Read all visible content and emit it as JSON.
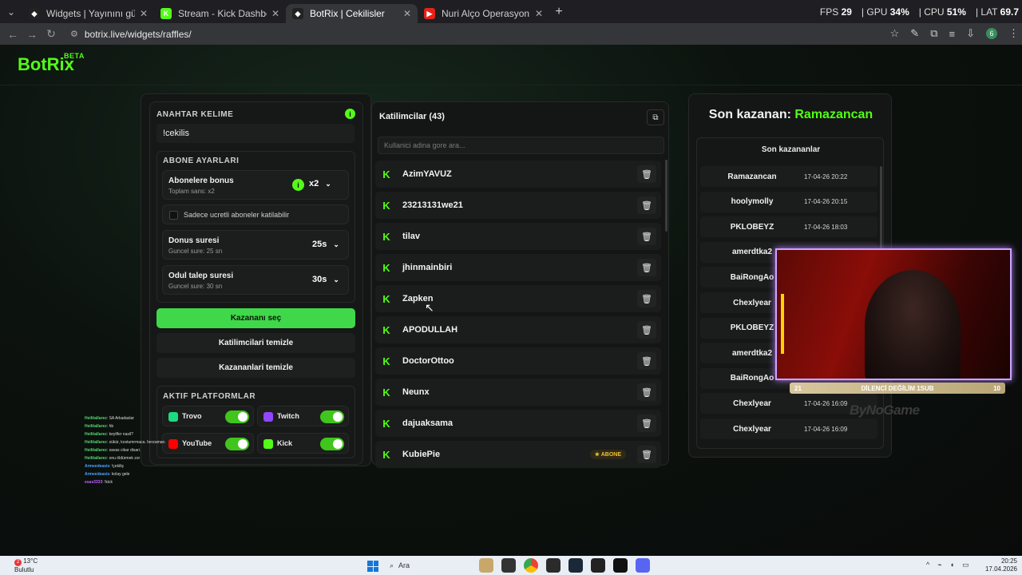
{
  "browser": {
    "tabs": [
      {
        "title": "Widgets | Yayınını güçlendirme…",
        "fav_color": "#222",
        "fav_glyph": "◆"
      },
      {
        "title": "Stream - Kick Dashboard",
        "fav_color": "#53fc18",
        "fav_glyph": "K"
      },
      {
        "title": "BotRix | Cekilisler",
        "fav_color": "#222",
        "fav_glyph": "◆"
      },
      {
        "title": "Nuri Alço Operasyon Müziği…",
        "fav_color": "#e62117",
        "fav_glyph": "▶"
      }
    ],
    "new_tab": "+",
    "url": "botrix.live/widgets/raffles/",
    "stats": {
      "fps_label": "FPS",
      "fps": "29",
      "gpu_label": "GPU",
      "gpu": "34",
      "cpu_label": "CPU",
      "cpu": "51",
      "lat_label": "LAT",
      "lat": "69.7"
    },
    "profile_initial": "6"
  },
  "brand": {
    "name": "BotRix",
    "beta": "BETA"
  },
  "settings": {
    "keyword_label": "ANAHTAR KELIME",
    "keyword_value": "!cekilis",
    "sub_settings_label": "ABONE AYARLARI",
    "sub_bonus_title": "Abonelere bonus",
    "sub_bonus_sub": "Toplam sans: x2",
    "sub_bonus_value": "x2",
    "paid_only_label": "Sadece ucretli aboneler katilabilir",
    "duration_title": "Donus suresi",
    "duration_sub": "Guncel sure: 25 sn",
    "duration_value": "25s",
    "claim_title": "Odul talep suresi",
    "claim_sub": "Guncel sure: 30 sn",
    "claim_value": "30s",
    "pick_winner": "Kazananı seç",
    "clear_participants": "Katilimcilari temizle",
    "clear_winners": "Kazananlari temizle",
    "platforms_label": "AKTIF PLATFORMLAR",
    "platforms": [
      {
        "name": "Trovo",
        "color": "#1cdb7f",
        "on": true
      },
      {
        "name": "Twitch",
        "color": "#9146ff",
        "on": true
      },
      {
        "name": "YouTube",
        "color": "#ff0000",
        "on": true
      },
      {
        "name": "Kick",
        "color": "#53fc18",
        "on": true
      }
    ]
  },
  "participants": {
    "title": "Katilimcilar (43)",
    "search_placeholder": "Kullanici adina gore ara...",
    "list": [
      {
        "name": "AzimYAVUZ",
        "badge": ""
      },
      {
        "name": "23213131we21",
        "badge": ""
      },
      {
        "name": "tilav",
        "badge": ""
      },
      {
        "name": "jhinmainbiri",
        "badge": ""
      },
      {
        "name": "Zapken",
        "badge": ""
      },
      {
        "name": "APODULLAH",
        "badge": ""
      },
      {
        "name": "DoctorOttoo",
        "badge": ""
      },
      {
        "name": "Neunx",
        "badge": ""
      },
      {
        "name": "dajuaksama",
        "badge": ""
      },
      {
        "name": "KubiePie",
        "badge": "ABONE"
      }
    ]
  },
  "winners": {
    "last_winner_label": "Son kazanan:",
    "last_winner_name": "Ramazancan",
    "list_title": "Son kazananlar",
    "list": [
      {
        "name": "Ramazancan",
        "date": "17-04-26 20:22"
      },
      {
        "name": "hoolymolly",
        "date": "17-04-26 20:15"
      },
      {
        "name": "PKLOBEYZ",
        "date": "17-04-26 18:03"
      },
      {
        "name": "amerdtka2",
        "date": ""
      },
      {
        "name": "BaiRongAo",
        "date": ""
      },
      {
        "name": "Chexlyear",
        "date": ""
      },
      {
        "name": "PKLOBEYZ",
        "date": ""
      },
      {
        "name": "amerdtka2",
        "date": ""
      },
      {
        "name": "BaiRongAo",
        "date": ""
      },
      {
        "name": "Chexlyear",
        "date": "17-04-26 16:09"
      },
      {
        "name": "Chexlyear",
        "date": "17-04-26 16:09"
      }
    ]
  },
  "overlay": {
    "cam_left": "21",
    "cam_text": "DİLENCİ DEĞİLİM 1SUB",
    "cam_right": "10",
    "sponsor": "ByNoGame"
  },
  "chat": [
    {
      "user": "Heilitallarez",
      "msg": "SA Arkadaslar"
    },
    {
      "user": "Heilitallarez",
      "msg": "hb"
    },
    {
      "user": "Heilitallarez",
      "msg": "keyifler nasil?"
    },
    {
      "user": "Heilitallarez",
      "msg": "sükür, kostumrmaca. herzaman."
    },
    {
      "user": "Heilitallarez",
      "msg": "savas cikar disari."
    },
    {
      "user": "Heilitallarez",
      "msg": "onu öldürmek zor"
    },
    {
      "user": "Armeedeasis",
      "msg": "!çekiliş"
    },
    {
      "user": "Armeedeasis",
      "msg": "kolay gele"
    },
    {
      "user": "esas3333",
      "msg": "!kick"
    }
  ],
  "taskbar": {
    "temp": "13°C",
    "weather": "Bulutlu",
    "weather_badge": "2",
    "search": "Ara",
    "time": "20:25",
    "date": "17.04.2026"
  }
}
